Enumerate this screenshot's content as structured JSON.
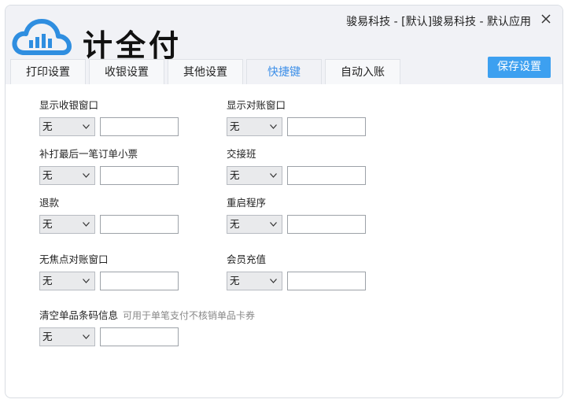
{
  "app": {
    "logo_text": "计全付",
    "title": "骏易科技 - [默认]骏易科技 - 默认应用"
  },
  "tabs": [
    {
      "label": "打印设置"
    },
    {
      "label": "收银设置"
    },
    {
      "label": "其他设置"
    },
    {
      "label": "快捷键",
      "active": true
    },
    {
      "label": "自动入账"
    }
  ],
  "toolbar": {
    "save_label": "保存设置"
  },
  "colors": {
    "accent": "#3da0f0",
    "active_tab_text": "#3d8fe8",
    "header_bg": "#f1f2f6"
  },
  "shortcuts": [
    {
      "label": "显示收银窗口",
      "key": "无",
      "value": ""
    },
    {
      "label": "显示对账窗口",
      "key": "无",
      "value": ""
    },
    {
      "label": "补打最后一笔订单小票",
      "key": "无",
      "value": ""
    },
    {
      "label": "交接班",
      "key": "无",
      "value": ""
    },
    {
      "label": "退款",
      "key": "无",
      "value": ""
    },
    {
      "label": "重启程序",
      "key": "无",
      "value": ""
    },
    {
      "label": "无焦点对账窗口",
      "key": "无",
      "value": ""
    },
    {
      "label": "会员充值",
      "key": "无",
      "value": ""
    },
    {
      "label": "清空单品条码信息",
      "hint": "可用于单笔支付不核销单品卡券",
      "key": "无",
      "value": ""
    }
  ]
}
